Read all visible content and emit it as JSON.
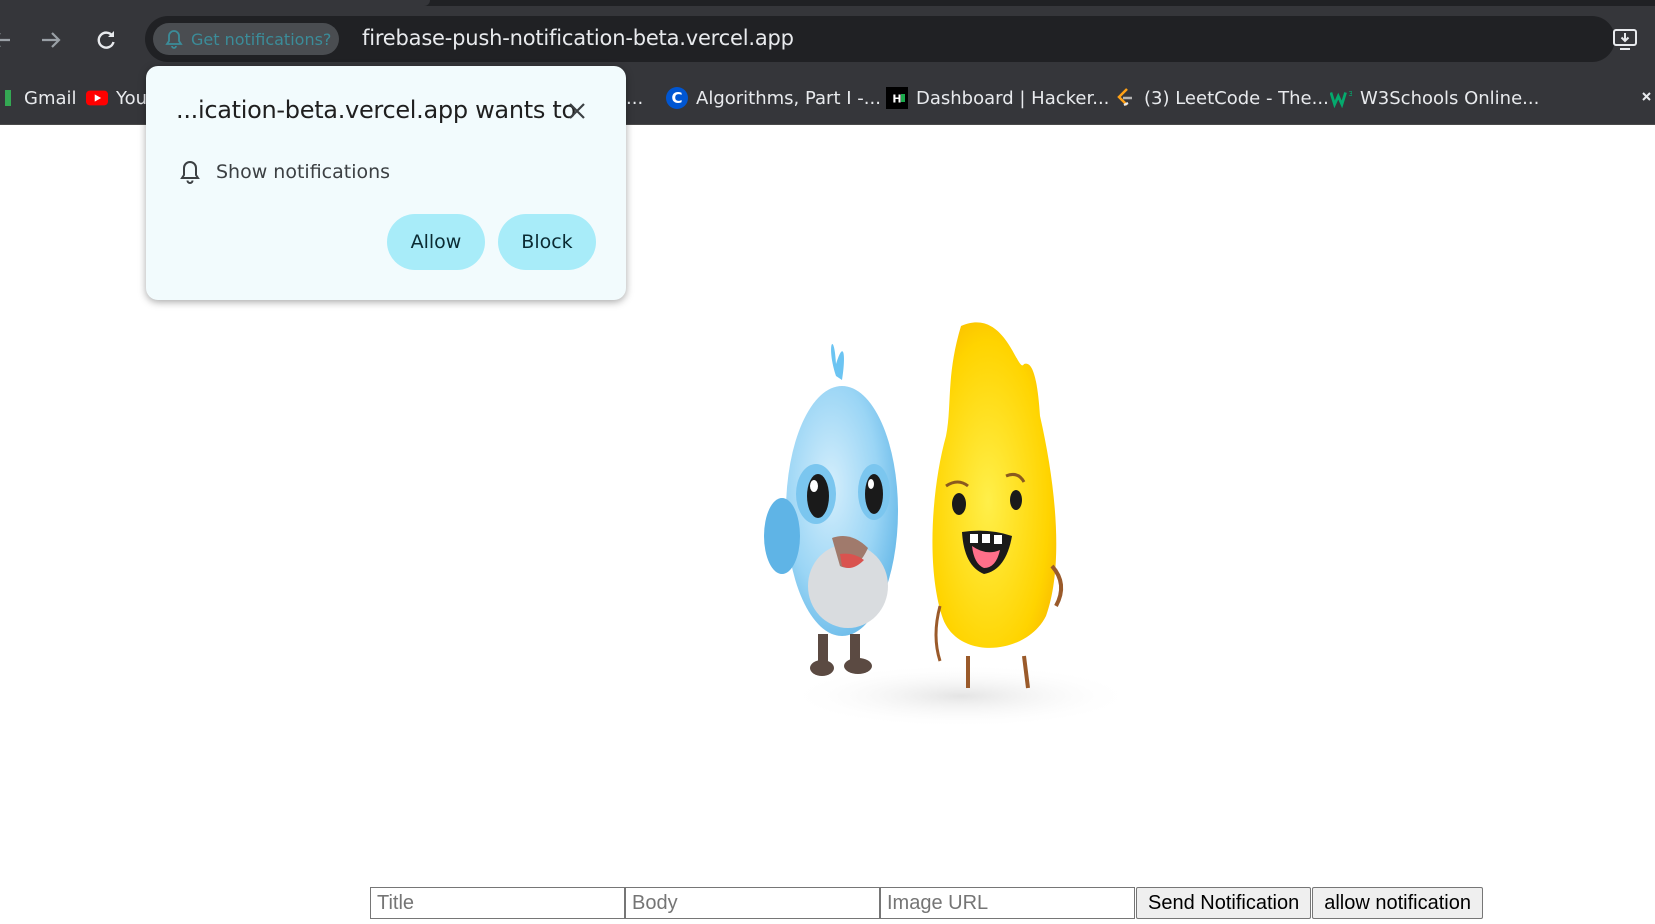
{
  "browser": {
    "notification_chip": "Get notifications?",
    "url": "firebase-push-notification-beta.vercel.app",
    "bookmarks": [
      {
        "label": "Gmail",
        "icon": "gmail-icon"
      },
      {
        "label": "You",
        "icon": "youtube-icon"
      },
      {
        "label": "...",
        "icon": ""
      },
      {
        "label": "Algorithms, Part I -...",
        "icon": "coursera-icon"
      },
      {
        "label": "Dashboard | Hacker...",
        "icon": "hackerrank-icon"
      },
      {
        "label": "(3) LeetCode - The...",
        "icon": "leetcode-icon"
      },
      {
        "label": "W3Schools Online...",
        "icon": "w3schools-icon"
      }
    ]
  },
  "popup": {
    "title": "...ication-beta.vercel.app wants to",
    "permission": "Show notifications",
    "allow_label": "Allow",
    "block_label": "Block"
  },
  "form": {
    "title_placeholder": "Title",
    "body_placeholder": "Body",
    "image_placeholder": "Image URL",
    "send_label": "Send Notification",
    "allow_label": "allow notification"
  },
  "colors": {
    "chrome": "#35363a",
    "popup_bg": "#f2fbfd",
    "pill": "#a8ecf9"
  }
}
